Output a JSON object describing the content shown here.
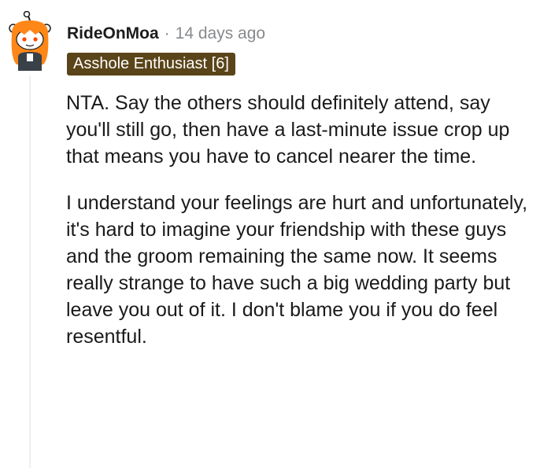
{
  "comment": {
    "username": "RideOnMoa",
    "separator": "·",
    "timestamp": "14 days ago",
    "flair": "Asshole Enthusiast [6]",
    "paragraphs": [
      "NTA. Say the others should definitely attend, say you'll still go, then have a last-minute issue crop up that means you have to cancel nearer the time.",
      "I understand your feelings are hurt and unfortunately, it's hard to imagine your friendship with these guys and the groom remaining the same now. It seems really strange to have such a big wedding party but leave you out of it. I don't blame you if you do feel resentful."
    ]
  },
  "colors": {
    "flair_bg": "#5a4419",
    "muted_text": "#878a8c",
    "thread_line": "#edeff1",
    "avatar_hair": "#ff8717"
  },
  "icons": {
    "avatar": "snoo-avatar-icon"
  }
}
